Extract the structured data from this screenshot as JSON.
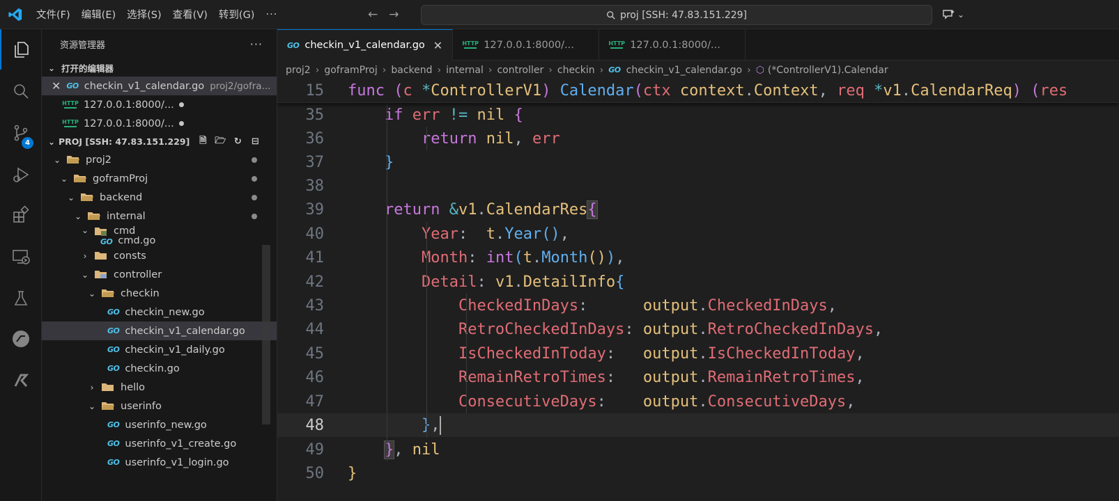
{
  "menu": {
    "items": [
      "文件(F)",
      "编辑(E)",
      "选择(S)",
      "查看(V)",
      "转到(G)"
    ],
    "more": "···"
  },
  "search": {
    "text": "proj [SSH: 47.83.151.229]"
  },
  "activity": {
    "scm_badge": "4"
  },
  "sidebar": {
    "title": "资源管理器",
    "more": "···",
    "open_editors": {
      "title": "打开的编辑器",
      "items": [
        {
          "name": "checkin_v1_calendar.go",
          "path": "proj2/gofra..."
        },
        {
          "name": "127.0.0.1:8000/..."
        },
        {
          "name": "127.0.0.1:8000/..."
        }
      ]
    },
    "project": {
      "title": "PROJ [SSH: 47.83.151.229]",
      "tree": [
        "proj2",
        "goframProj",
        "backend",
        "internal",
        "cmd",
        "cmd.go",
        "consts",
        "controller",
        "checkin",
        "checkin_new.go",
        "checkin_v1_calendar.go",
        "checkin_v1_daily.go",
        "checkin.go",
        "hello",
        "userinfo",
        "userinfo_new.go",
        "userinfo_v1_create.go",
        "userinfo_v1_login.go"
      ]
    }
  },
  "tabs": [
    {
      "label": "checkin_v1_calendar.go",
      "active": true
    },
    {
      "label": "127.0.0.1:8000/..."
    },
    {
      "label": "127.0.0.1:8000/..."
    }
  ],
  "breadcrumb": [
    "proj2",
    "goframProj",
    "backend",
    "internal",
    "controller",
    "checkin",
    "checkin_v1_calendar.go",
    "(*ControllerV1).Calendar"
  ],
  "editor": {
    "current_line": "48",
    "line_numbers": [
      "15",
      "35",
      "36",
      "37",
      "38",
      "39",
      "40",
      "41",
      "42",
      "43",
      "44",
      "45",
      "46",
      "47",
      "48",
      "49",
      "50"
    ]
  },
  "colors": {
    "accent": "#0078d4",
    "go_icon": "#4fc1e9",
    "http_icon": "#27b07a",
    "folder": "#dcb67a"
  }
}
